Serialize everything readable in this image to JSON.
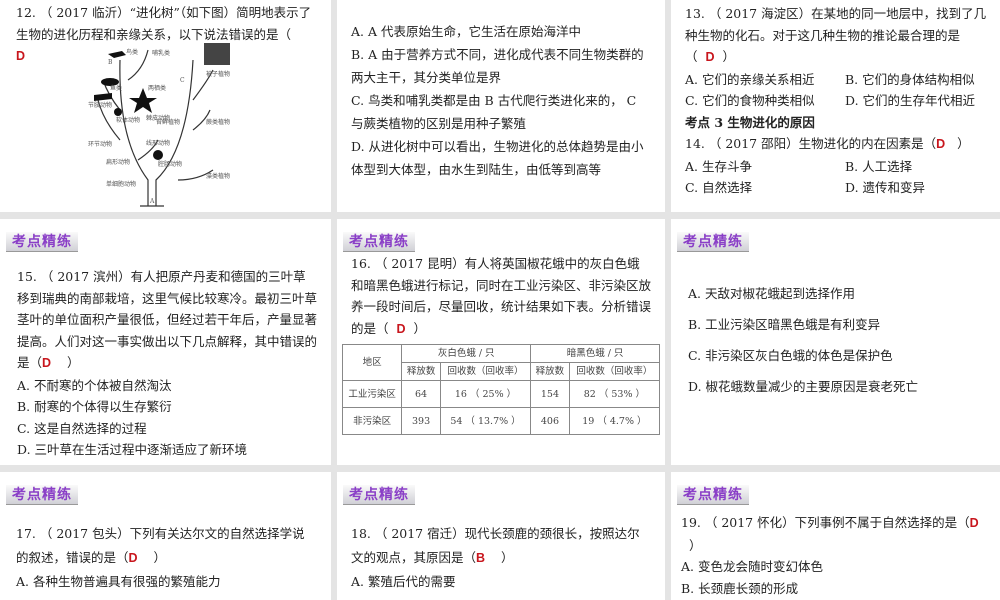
{
  "q12": {
    "stem": "12. （ 2017 临沂）“进化树”（如下图）简明地表示了生物的进化历程和亲缘关系，以下说法错误的是（",
    "answer": "D",
    "close": "）",
    "tree_labels": [
      "鸟类",
      "哺乳类",
      "被子植物",
      "鱼类",
      "两栖类",
      "节肢动物",
      "棘皮动物",
      "软体动物",
      "苔藓植物",
      "蕨类植物",
      "环节动物",
      "线形动物",
      "扁形动物",
      "腔肠动物",
      "藻类植物",
      "单细胞动物",
      "A",
      "B",
      "C"
    ],
    "options": [
      "A. A 代表原始生命，它生活在原始海洋中",
      "B. A 由于营养方式不同，进化成代表不同生物类群的两大主干，其分类单位是界",
      "C. 鸟类和哺乳类都是由 B 古代爬行类进化来的， C 与蕨类植物的区别是用种子繁殖",
      "D. 从进化树中可以看出，生物进化的总体趋势是由小体型到大体型，由水生到陆生，由低等到高等"
    ]
  },
  "q13": {
    "stem": "13. （ 2017 海淀区）在某地的同一地层中，找到了几种生物的化石。对于这几种生物的推论最合理的是",
    "open": "（",
    "answer": "D",
    "close": "）",
    "options": [
      "A. 它们的亲缘关系相近",
      "B. 它们的身体结构相似",
      "C. 它们的食物种类相似",
      "D. 它们的生存年代相近"
    ]
  },
  "section3": "考点 3  生物进化的原因",
  "q14": {
    "stem": "14. （ 2017 邵阳）生物进化的内在因素是（",
    "answer": "D",
    "close": "）",
    "options": [
      "A. 生存斗争",
      "B. 人工选择",
      "C. 自然选择",
      "D. 遗传和变异"
    ]
  },
  "badge": "考点精练",
  "q15": {
    "stem": "15. （ 2017 滨州）有人把原产丹麦和德国的三叶草移到瑞典的南部栽培，这里气候比较寒冷。最初三叶草茎叶的单位面积产量很低，但经过若干年后，产量显著提高。人们对这一事实做出以下几点解释，其中错误的是（",
    "answer": "D",
    "close": "）",
    "options": [
      "A. 不耐寒的个体被自然淘汰",
      "B. 耐寒的个体得以生存繁衍",
      "C. 这是自然选择的过程",
      "D. 三叶草在生活过程中逐渐适应了新环境"
    ]
  },
  "q16": {
    "stem": "16. （ 2017 昆明）有人将英国椒花蛾中的灰白色蛾和暗黑色蛾进行标记，同时在工业污染区、非污染区放养一段时间后，尽量回收，统计结果如下表。分析错误的是（",
    "answer": "D",
    "close": "）",
    "table": {
      "region": "地区",
      "group1": "灰白色蛾 / 只",
      "group2": "暗黑色蛾 / 只",
      "released": "释放数",
      "recovered": "回收数（回收率）",
      "rows": [
        [
          "工业污染区",
          "64",
          "16 （ 25% ）",
          "154",
          "82 （ 53% ）"
        ],
        [
          "非污染区",
          "393",
          "54 （ 13.7% ）",
          "406",
          "19 （ 4.7% ）"
        ]
      ]
    },
    "options": [
      "A. 天敌对椒花蛾起到选择作用",
      "B. 工业污染区暗黑色蛾是有利变异",
      "C. 非污染区灰白色蛾的体色是保护色",
      "D. 椒花蛾数量减少的主要原因是衰老死亡"
    ]
  },
  "q17": {
    "stem": "17. （ 2017 包头）下列有关达尔文的自然选择学说的叙述，错误的是（",
    "answer": "D",
    "close": "）",
    "options": [
      "A. 各种生物普遍具有很强的繁殖能力"
    ]
  },
  "q18": {
    "stem": "18. （ 2017 宿迁）现代长颈鹿的颈很长，按照达尔文的观点，其原因是（",
    "answer": "B",
    "close": "）",
    "options": [
      "A. 繁殖后代的需要"
    ]
  },
  "q19": {
    "stem": "19. （ 2017 怀化）下列事例不属于自然选择的是（",
    "answer": "D",
    "close": "）",
    "options": [
      "A. 变色龙会随时变幻体色",
      "B. 长颈鹿长颈的形成"
    ]
  }
}
